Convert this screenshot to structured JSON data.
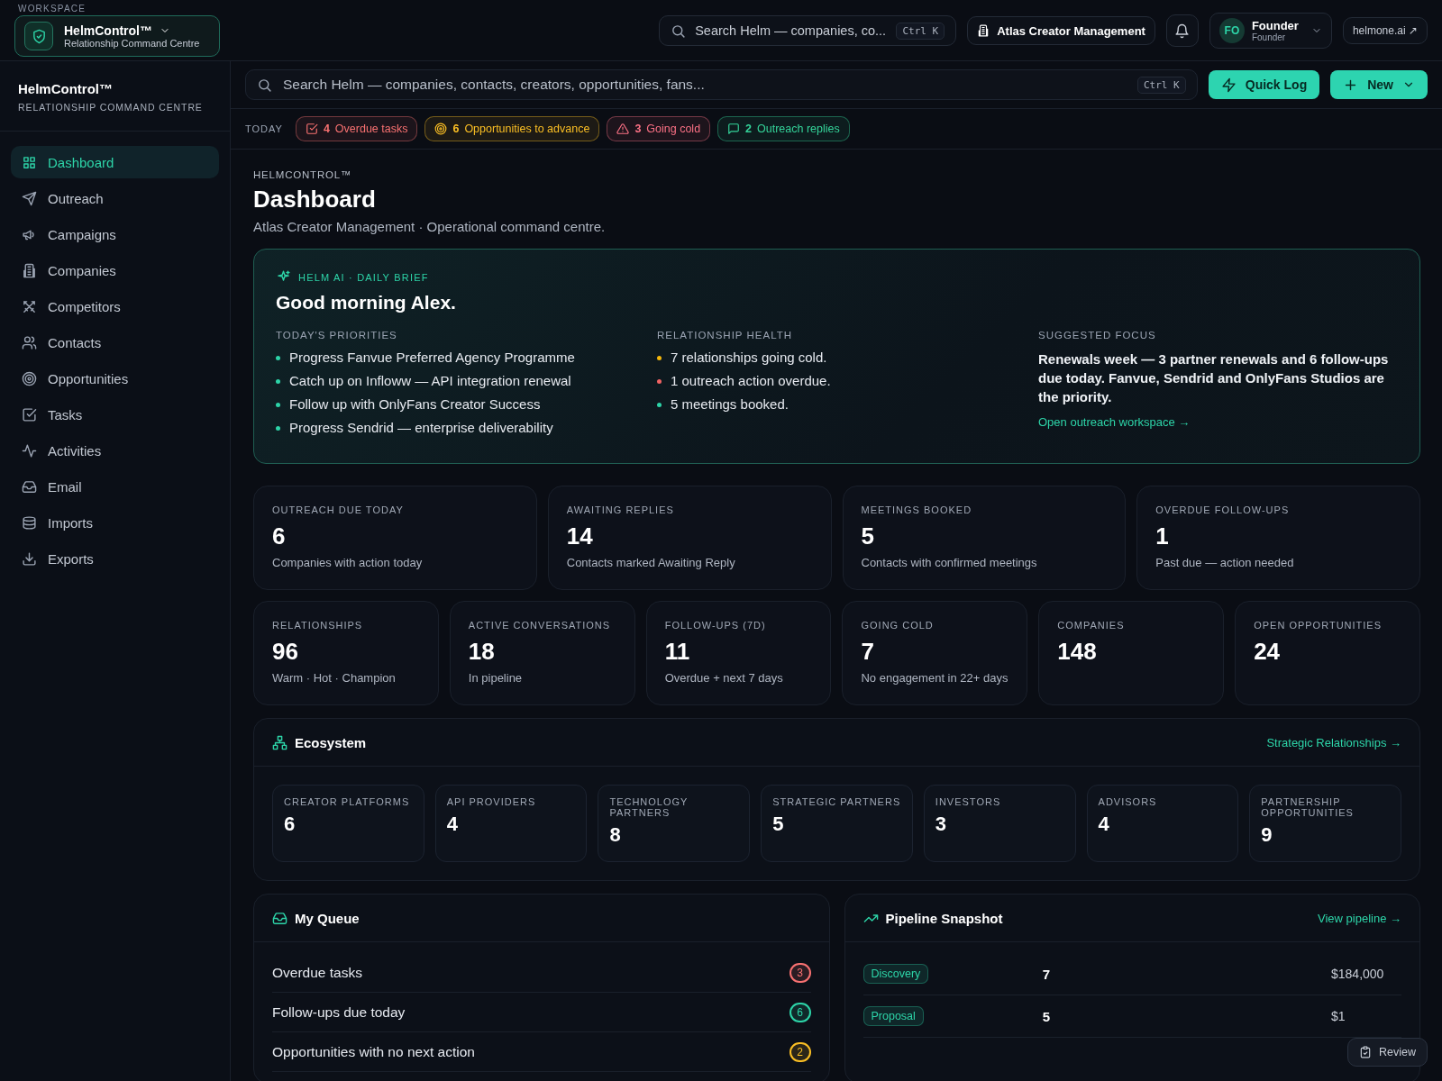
{
  "workspace": {
    "label": "WORKSPACE",
    "name": "HelmControl™",
    "subtitle": "Relationship Command Centre"
  },
  "topbar": {
    "search": {
      "placeholder": "Search Helm — companies, co...",
      "shortcut": "Ctrl K"
    },
    "organization": "Atlas Creator Management",
    "user": {
      "initials": "FO",
      "name": "Founder",
      "role": "Founder"
    },
    "domain_link": "helmone.ai ↗"
  },
  "sidebar": {
    "title": "HelmControl™",
    "subtitle": "RELATIONSHIP COMMAND CENTRE",
    "items": [
      {
        "label": "Dashboard",
        "selected": true
      },
      {
        "label": "Outreach",
        "selected": false
      },
      {
        "label": "Campaigns",
        "selected": false
      },
      {
        "label": "Companies",
        "selected": false
      },
      {
        "label": "Competitors",
        "selected": false
      },
      {
        "label": "Contacts",
        "selected": false
      },
      {
        "label": "Opportunities",
        "selected": false
      },
      {
        "label": "Tasks",
        "selected": false
      },
      {
        "label": "Activities",
        "selected": false
      },
      {
        "label": "Email",
        "selected": false
      },
      {
        "label": "Imports",
        "selected": false
      },
      {
        "label": "Exports",
        "selected": false
      }
    ]
  },
  "search_bar": {
    "placeholder": "Search Helm — companies, contacts, creators, opportunities, fans...",
    "shortcut": "Ctrl K"
  },
  "actions": {
    "quick_log": "Quick Log",
    "new": "New"
  },
  "today": {
    "label": "TODAY",
    "chips": [
      {
        "count": "4",
        "label": "Overdue tasks",
        "color": "#f87171"
      },
      {
        "count": "6",
        "label": "Opportunities to advance",
        "color": "#fbbf24"
      },
      {
        "count": "3",
        "label": "Going cold",
        "color": "#fb7185"
      },
      {
        "count": "2",
        "label": "Outreach replies",
        "color": "#34d399"
      }
    ]
  },
  "page": {
    "breadcrumb": "HELMCONTROL™",
    "title": "Dashboard",
    "subtitle": "Atlas Creator Management · Operational command centre."
  },
  "brief": {
    "label": "HELM AI · DAILY BRIEF",
    "greeting": "Good morning Alex.",
    "priorities": {
      "heading": "TODAY'S PRIORITIES",
      "items": [
        "Progress Fanvue Preferred Agency Programme",
        "Catch up on Infloww — API integration renewal",
        "Follow up with OnlyFans Creator Success",
        "Progress Sendrid — enterprise deliverability"
      ]
    },
    "health": {
      "heading": "RELATIONSHIP HEALTH",
      "items": [
        {
          "text": "7 relationships going cold.",
          "color": "#f5b70b"
        },
        {
          "text": "1 outreach action overdue.",
          "color": "#f06363"
        },
        {
          "text": "5 meetings booked.",
          "color": "#2dd4a8"
        }
      ]
    },
    "focus": {
      "heading": "SUGGESTED FOCUS",
      "text": "Renewals week — 3 partner renewals and 6 follow-ups due today. Fanvue, Sendrid and OnlyFans Studios are the priority.",
      "link": "Open outreach workspace →"
    }
  },
  "stats_primary": [
    {
      "label": "OUTREACH DUE TODAY",
      "value": "6",
      "note": "Companies with action today"
    },
    {
      "label": "AWAITING REPLIES",
      "value": "14",
      "note": "Contacts marked Awaiting Reply"
    },
    {
      "label": "MEETINGS BOOKED",
      "value": "5",
      "note": "Contacts with confirmed meetings"
    },
    {
      "label": "OVERDUE FOLLOW-UPS",
      "value": "1",
      "note": "Past due — action needed"
    }
  ],
  "stats_secondary": [
    {
      "label": "RELATIONSHIPS",
      "value": "96",
      "note": "Warm · Hot · Champion"
    },
    {
      "label": "ACTIVE CONVERSATIONS",
      "value": "18",
      "note": "In pipeline"
    },
    {
      "label": "FOLLOW-UPS (7D)",
      "value": "11",
      "note": "Overdue + next 7 days"
    },
    {
      "label": "GOING COLD",
      "value": "7",
      "note": "No engagement in 22+ days"
    },
    {
      "label": "COMPANIES",
      "value": "148"
    },
    {
      "label": "OPEN OPPORTUNITIES",
      "value": "24"
    }
  ],
  "ecosystem": {
    "title": "Ecosystem",
    "link": "Strategic Relationships →",
    "items": [
      {
        "label": "CREATOR PLATFORMS",
        "value": "6"
      },
      {
        "label": "API PROVIDERS",
        "value": "4"
      },
      {
        "label": "TECHNOLOGY PARTNERS",
        "value": "8"
      },
      {
        "label": "STRATEGIC PARTNERS",
        "value": "5"
      },
      {
        "label": "INVESTORS",
        "value": "3"
      },
      {
        "label": "ADVISORS",
        "value": "4"
      },
      {
        "label": "PARTNERSHIP OPPORTUNITIES",
        "value": "9"
      }
    ]
  },
  "queue": {
    "title": "My Queue",
    "items": [
      {
        "label": "Overdue tasks",
        "count": "3",
        "color": "#f87171"
      },
      {
        "label": "Follow-ups due today",
        "count": "6",
        "color": "#2dd4a8"
      },
      {
        "label": "Opportunities with no next action",
        "count": "2",
        "color": "#fbbf24"
      }
    ]
  },
  "pipeline": {
    "title": "Pipeline Snapshot",
    "link": "View pipeline →",
    "rows": [
      {
        "stage": "Discovery",
        "count": "7",
        "amount": "$184,000"
      },
      {
        "stage": "Proposal",
        "count": "5",
        "amount": "$1"
      }
    ]
  },
  "review_button": "Review"
}
